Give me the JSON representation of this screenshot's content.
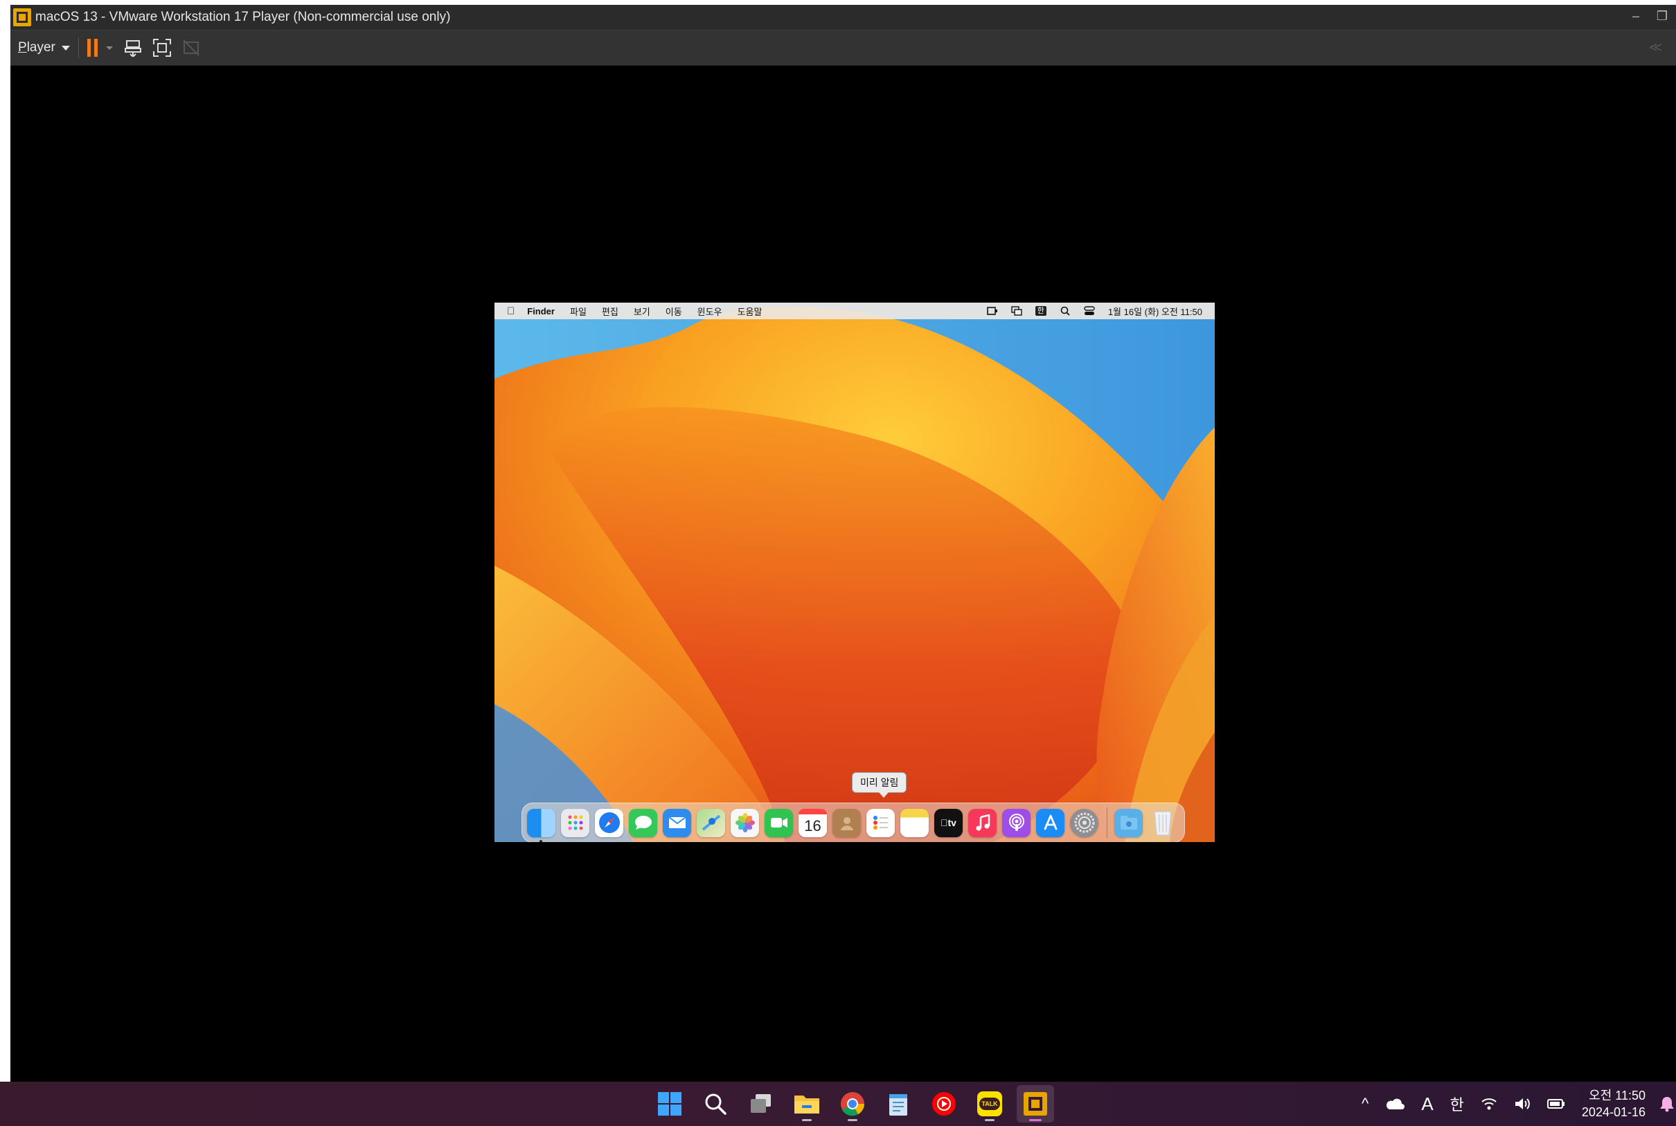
{
  "window": {
    "title": "macOS 13 - VMware Workstation 17 Player (Non-commercial use only)",
    "controls": [
      "minimize-icon",
      "restore-icon"
    ]
  },
  "toolbar": {
    "player_first": "P",
    "player_rest": "layer",
    "icons": [
      "pause-icon",
      "send-ctrl-alt-del-icon",
      "fullscreen-icon",
      "unity-icon"
    ]
  },
  "mac": {
    "menubar": {
      "apple_glyph": "",
      "app_name": "Finder",
      "items": [
        "파일",
        "편집",
        "보기",
        "이동",
        "윈도우",
        "도움말"
      ],
      "ime_label": "한",
      "clock": "1월 16일 (화) 오전 11:50"
    },
    "tooltip": "미리 알림",
    "dock": {
      "calendar_day": "16",
      "tv_label": "tv",
      "apps": [
        {
          "name": "finder",
          "color": "#2a8df0"
        },
        {
          "name": "launchpad",
          "color": "#e9e9ee"
        },
        {
          "name": "safari",
          "color": "#1e7cf0"
        },
        {
          "name": "messages",
          "color": "#34c759"
        },
        {
          "name": "mail",
          "color": "#2d8cf0"
        },
        {
          "name": "maps",
          "color": "#7bc86c"
        },
        {
          "name": "photos",
          "color": "#f7f7f7"
        },
        {
          "name": "facetime",
          "color": "#2fc34f"
        },
        {
          "name": "calendar",
          "color": "#ffffff"
        },
        {
          "name": "contacts",
          "color": "#b08050"
        },
        {
          "name": "reminders",
          "color": "#ffffff"
        },
        {
          "name": "notes",
          "color": "#f7d54a"
        },
        {
          "name": "apple-tv",
          "color": "#111111"
        },
        {
          "name": "music",
          "color": "#f8385a"
        },
        {
          "name": "podcasts",
          "color": "#9f4de8"
        },
        {
          "name": "app-store",
          "color": "#1a8cf5"
        },
        {
          "name": "system-settings",
          "color": "#8e8e93"
        }
      ],
      "right": [
        {
          "name": "downloads-folder",
          "color": "#59b0e8"
        },
        {
          "name": "trash",
          "color": "#e8eaee"
        }
      ]
    }
  },
  "taskbar": {
    "apps": [
      "start",
      "search",
      "task-view",
      "file-explorer",
      "chrome",
      "notepad",
      "youtube-music",
      "kakaotalk",
      "vmware-player"
    ],
    "kakao_label": "TALK",
    "tray": {
      "chevron": "^",
      "ime_a": "A",
      "ime_han": "한"
    },
    "clock_time": "오전 11:50",
    "clock_date": "2024-01-16"
  },
  "colors": {
    "vm_accent": "#f07a17",
    "taskbar_active": "#e46bd5"
  }
}
